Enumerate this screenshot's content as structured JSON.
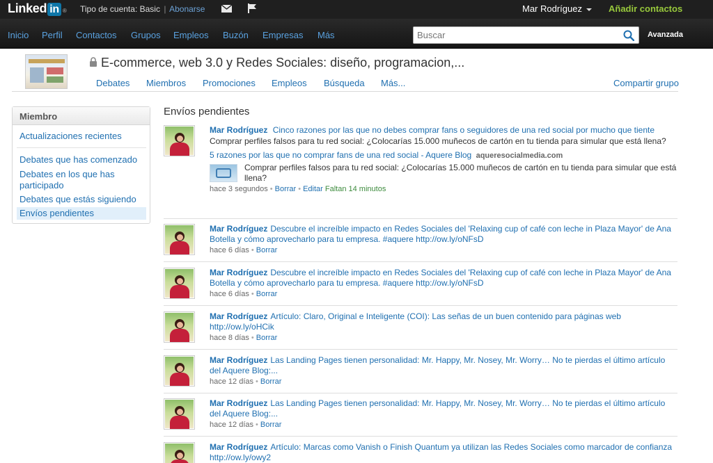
{
  "topbar": {
    "logo_text": "Linked",
    "logo_in": "in",
    "logo_reg": "®",
    "account_type": "Tipo de cuenta: Basic",
    "separator": "|",
    "upgrade": "Abonarse",
    "user_name": "Mar Rodríguez",
    "add_contacts": "Añadir contactos"
  },
  "nav": {
    "items": [
      "Inicio",
      "Perfil",
      "Contactos",
      "Grupos",
      "Empleos",
      "Buzón",
      "Empresas",
      "Más"
    ],
    "search_placeholder": "Buscar",
    "advanced": "Avanzada"
  },
  "group": {
    "title": "E-commerce, web 3.0 y Redes Sociales: diseño, programacion,...",
    "tabs": [
      "Debates",
      "Miembros",
      "Promociones",
      "Empleos",
      "Búsqueda",
      "Más..."
    ],
    "share": "Compartir grupo"
  },
  "sidebar": {
    "heading": "Miembro",
    "items": [
      "Actualizaciones recientes",
      "Debates que has comenzado",
      "Debates en los que has participado",
      "Debates que estás siguiendo",
      "Envíos pendientes"
    ],
    "active_index": 4
  },
  "feed": {
    "title": "Envíos pendientes",
    "posts": [
      {
        "author": "Mar Rodríguez",
        "text": "Cinco razones por las que no debes comprar fans o seguidores de una red social por mucho que tiente",
        "detail": "Comprar perfiles falsos para tu red social: ¿Colocarías 15.000 muñecos de cartón en tu tienda para simular que está llena?",
        "link_title": "5 razones por las que no comprar fans de una red social - Aquere Blog",
        "link_domain": "aqueresocialmedia.com",
        "link_desc": "Comprar perfiles falsos para tu red social: ¿Colocarías 15.000 muñecos de cartón en tu tienda para simular que está llena?",
        "time": "hace 3 segundos",
        "delete": "Borrar",
        "edit": "Editar",
        "edit_note": "Faltan 14 minutos"
      },
      {
        "author": "Mar Rodríguez",
        "text": "Descubre el increíble impacto en Redes Sociales del 'Relaxing cup of café con leche in Plaza Mayor' de Ana Botella y cómo aprovecharlo para tu empresa. #aquere http://ow.ly/oNFsD",
        "time": "hace 6 días",
        "delete": "Borrar"
      },
      {
        "author": "Mar Rodríguez",
        "text": "Descubre el increíble impacto en Redes Sociales del 'Relaxing cup of café con leche in Plaza Mayor' de Ana Botella y cómo aprovecharlo para tu empresa. #aquere http://ow.ly/oNFsD",
        "time": "hace 6 días",
        "delete": "Borrar"
      },
      {
        "author": "Mar Rodríguez",
        "text": "Artículo: Claro, Original e Inteligente (COI): Las señas de un buen contenido para páginas web http://ow.ly/oHCik",
        "time": "hace 8 días",
        "delete": "Borrar"
      },
      {
        "author": "Mar Rodríguez",
        "text": "Las Landing Pages tienen personalidad: Mr. Happy, Mr. Nosey, Mr. Worry… No te pierdas el último artículo del Aquere Blog:...",
        "time": "hace 12 días",
        "delete": "Borrar"
      },
      {
        "author": "Mar Rodríguez",
        "text": "Las Landing Pages tienen personalidad: Mr. Happy, Mr. Nosey, Mr. Worry… No te pierdas el último artículo del Aquere Blog:...",
        "time": "hace 12 días",
        "delete": "Borrar"
      },
      {
        "author": "Mar Rodríguez",
        "text": "Artículo: Marcas como Vanish o Finish Quantum ya utilizan las Redes Sociales como marcador de confianza http://ow.ly/owy2",
        "time": "",
        "delete": ""
      }
    ]
  },
  "colors": {
    "link_blue": "#1f6fb0",
    "nav_blue": "#5aa2e0",
    "topbar_bg": "#1f1f1f",
    "add_contacts_green": "#98c93c",
    "active_item_bg": "#e1effa"
  },
  "icons": [
    "mail-icon",
    "flag-icon",
    "search-icon",
    "lock-icon",
    "chevron-down-icon"
  ]
}
